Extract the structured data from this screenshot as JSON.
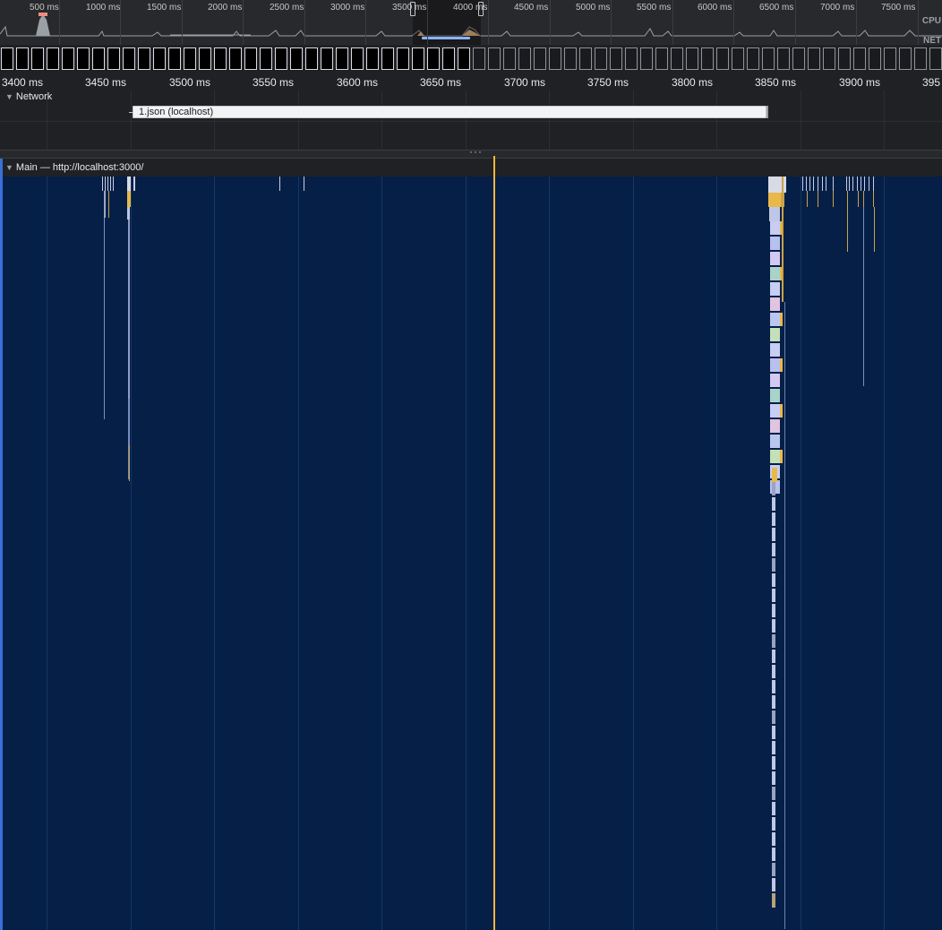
{
  "overview": {
    "tick_labels": [
      "500 ms",
      "1000 ms",
      "1500 ms",
      "2000 ms",
      "2500 ms",
      "3000 ms",
      "3500 ms",
      "4000 ms",
      "4500 ms",
      "5000 ms",
      "5500 ms",
      "6000 ms",
      "6500 ms",
      "7000 ms",
      "7500 ms"
    ],
    "cpu_label": "CPU",
    "net_label": "NET"
  },
  "ruler": {
    "tick_labels": [
      "3400 ms",
      "3450 ms",
      "3500 ms",
      "3550 ms",
      "3600 ms",
      "3650 ms",
      "3700 ms",
      "3750 ms",
      "3800 ms",
      "3850 ms",
      "3900 ms",
      "395"
    ]
  },
  "network": {
    "title": "Network",
    "request_label": "1.json (localhost)"
  },
  "main": {
    "title": "Main — http://localhost:3000/"
  },
  "colors": {
    "selection_line": "#8ab4f8",
    "cursor": "#f6b73c",
    "main_background": "#051f47",
    "frame_border": "#dadce0"
  }
}
